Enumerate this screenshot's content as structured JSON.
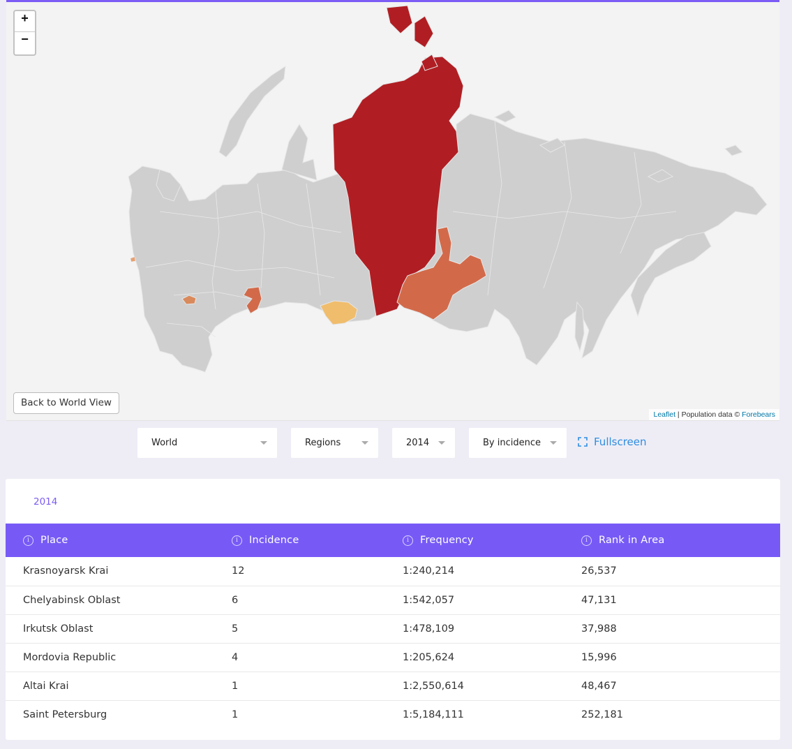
{
  "map": {
    "zoom_in": "+",
    "zoom_out": "−",
    "back_button": "Back to World View",
    "attribution": {
      "leaflet": "Leaflet",
      "separator": " | Population data © ",
      "source": "Forebears"
    },
    "colors": {
      "land": "#cfcfcf",
      "background": "#f3f3f3",
      "highest": "#b01e23",
      "high": "#d26a4a",
      "low": "#f0bd6c"
    }
  },
  "controls": {
    "area": "World",
    "level": "Regions",
    "year": "2014",
    "mode": "By incidence",
    "fullscreen": "Fullscreen"
  },
  "table": {
    "year_label": "2014",
    "headers": [
      "Place",
      "Incidence",
      "Frequency",
      "Rank in Area"
    ],
    "rows": [
      [
        "Krasnoyarsk Krai",
        "12",
        "1:240,214",
        "26,537"
      ],
      [
        "Chelyabinsk Oblast",
        "6",
        "1:542,057",
        "47,131"
      ],
      [
        "Irkutsk Oblast",
        "5",
        "1:478,109",
        "37,988"
      ],
      [
        "Mordovia Republic",
        "4",
        "1:205,624",
        "15,996"
      ],
      [
        "Altai Krai",
        "1",
        "1:2,550,614",
        "48,467"
      ],
      [
        "Saint Petersburg",
        "1",
        "1:5,184,111",
        "252,181"
      ]
    ]
  }
}
